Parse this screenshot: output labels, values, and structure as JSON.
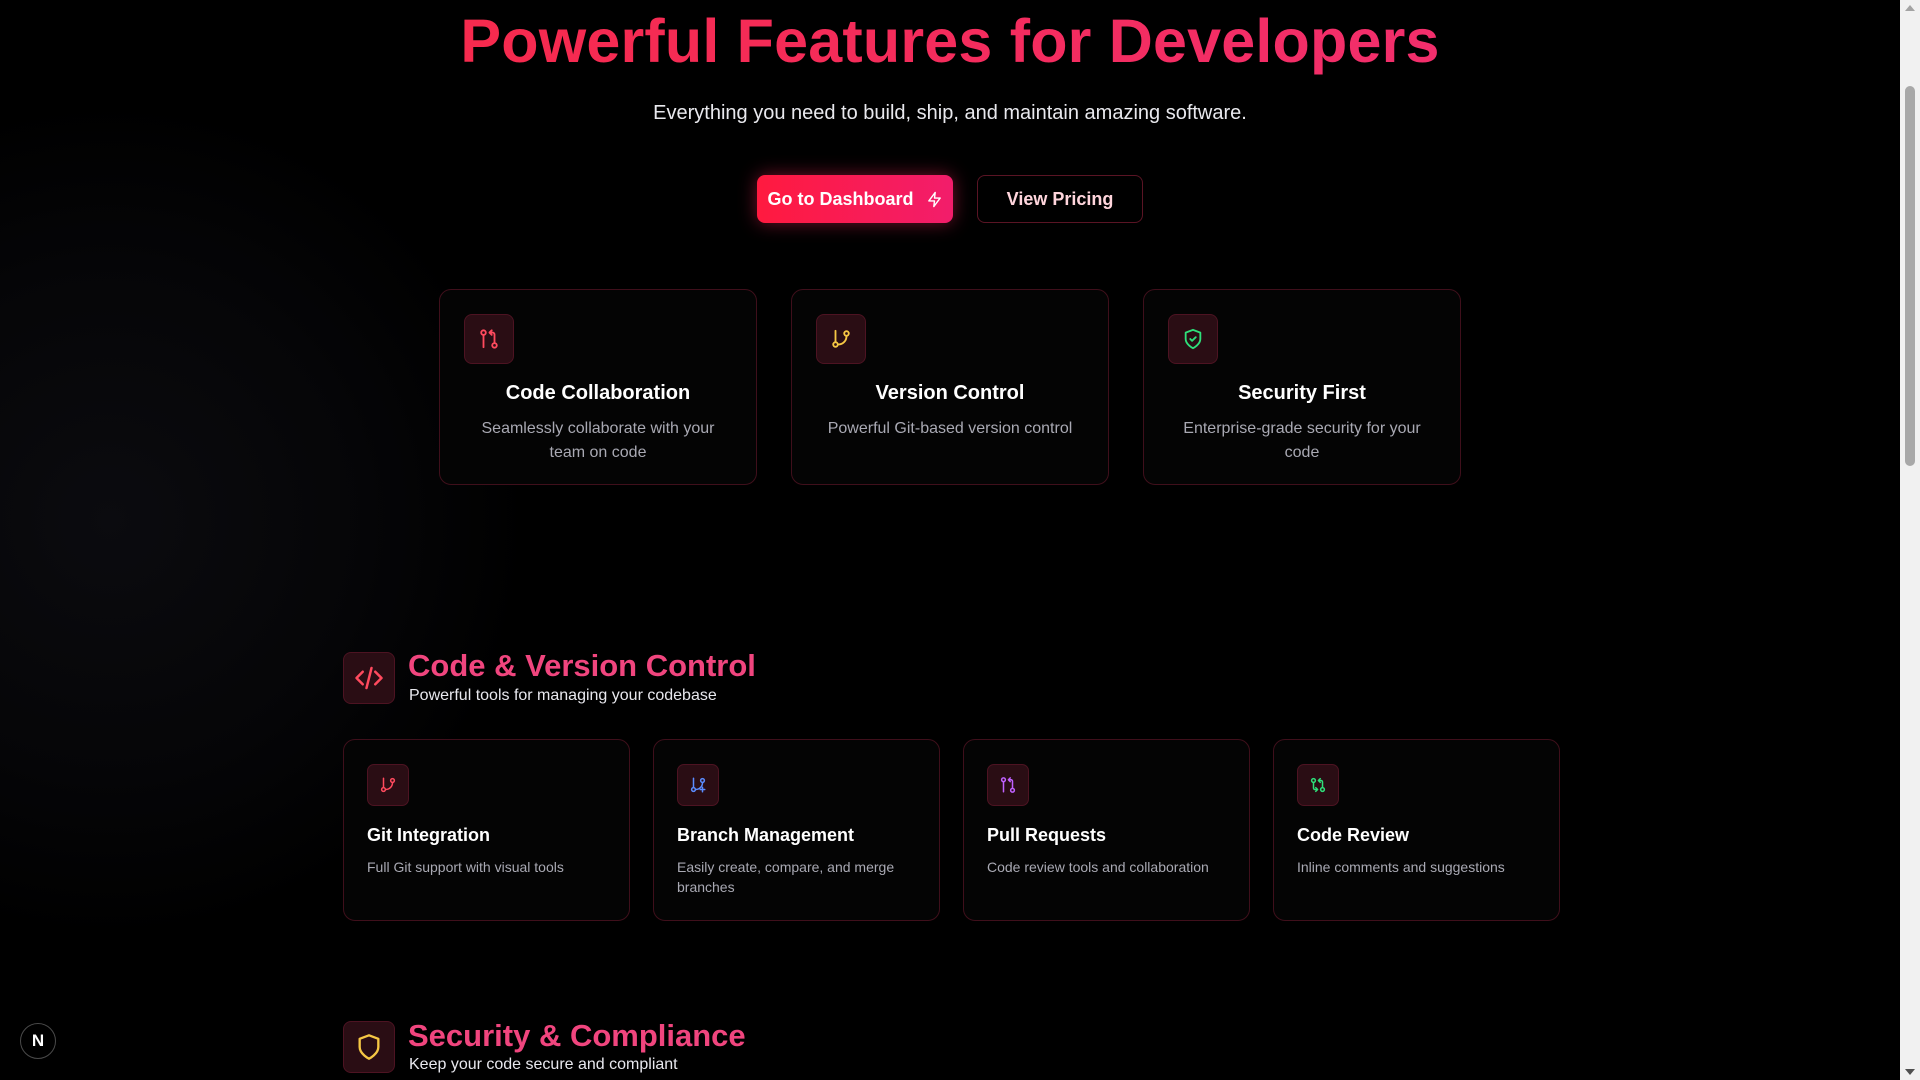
{
  "hero": {
    "title": "Powerful Features for Developers",
    "subtitle": "Everything you need to build, ship, and maintain amazing software.",
    "primary_button": "Go to Dashboard",
    "secondary_button": "View Pricing"
  },
  "top_cards": [
    {
      "icon": "git-pull-request-icon",
      "title": "Code Collaboration",
      "description": "Seamlessly collaborate with your team on code"
    },
    {
      "icon": "git-branch-icon",
      "title": "Version Control",
      "description": "Powerful Git-based version control"
    },
    {
      "icon": "shield-check-icon",
      "title": "Security First",
      "description": "Enterprise-grade security for your code"
    }
  ],
  "sections": [
    {
      "icon": "code-icon",
      "title": "Code & Version Control",
      "subtitle": "Powerful tools for managing your codebase",
      "cards": [
        {
          "icon": "git-branch-icon",
          "title": "Git Integration",
          "description": "Full Git support with visual tools"
        },
        {
          "icon": "git-branch-plus-icon",
          "title": "Branch Management",
          "description": "Easily create, compare, and merge branches"
        },
        {
          "icon": "git-pull-request-icon",
          "title": "Pull Requests",
          "description": "Code review tools and collaboration"
        },
        {
          "icon": "git-compare-icon",
          "title": "Code Review",
          "description": "Inline comments and suggestions"
        }
      ]
    },
    {
      "icon": "shield-icon",
      "title": "Security & Compliance",
      "subtitle": "Keep your code secure and compliant"
    }
  ],
  "next_badge": "N",
  "colors": {
    "accent": "#f21d4f",
    "accent_pink": "#f0457e",
    "card_border": "#3f0f1b",
    "background": "#000000"
  }
}
